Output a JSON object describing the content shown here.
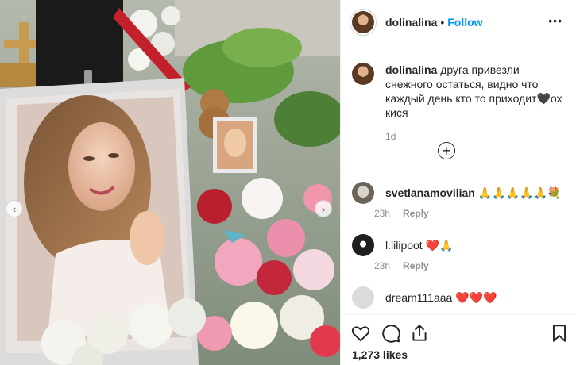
{
  "post": {
    "username": "dolinalina",
    "separator": "•",
    "follow_label": "Follow",
    "more_label": "•••",
    "caption": {
      "username": "dolinalina",
      "text": "друга привезли снежного остаться, видно что каждый день кто то приходит🖤ох кися",
      "time": "1d"
    },
    "load_more_label": "+",
    "comments": [
      {
        "username": "svetlanamovilian",
        "text": "🙏🙏🙏🙏🙏💐",
        "time": "23h",
        "reply_label": "Reply"
      },
      {
        "username": "l.lilipoot",
        "text": "❤️🙏",
        "time": "23h",
        "reply_label": "Reply"
      },
      {
        "username": "dream111aaa",
        "text": "❤️❤️❤️"
      }
    ],
    "likes": "1,273 likes",
    "icons": {
      "like": "heart-icon",
      "comment": "comment-bubble-icon",
      "share": "share-icon",
      "save": "bookmark-icon",
      "carousel_prev": "chevron-left-icon",
      "carousel_next": "chevron-right-icon"
    },
    "colors": {
      "follow": "#0095f6",
      "muted": "#8e8e8e",
      "heart": "#ed4956"
    }
  }
}
